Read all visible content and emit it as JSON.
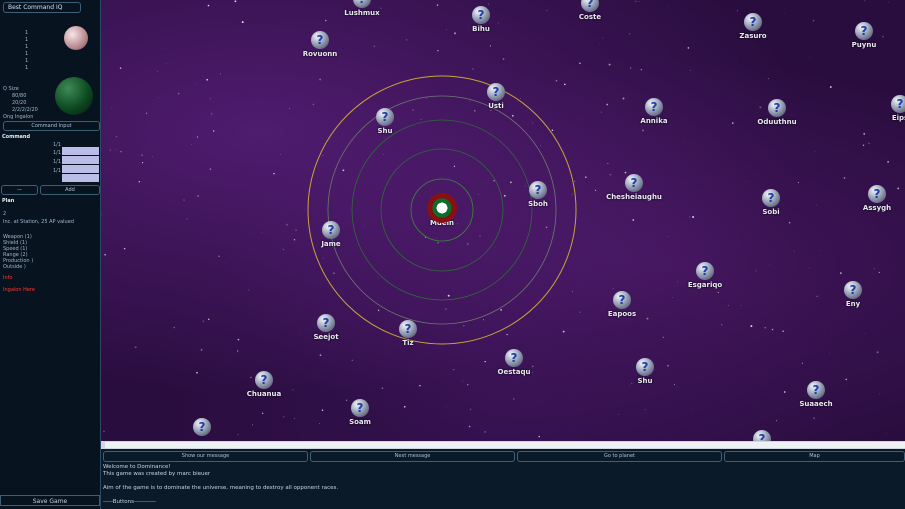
{
  "left_panel": {
    "title": "Best Command IQ",
    "rows_top": [
      "1",
      "1",
      "1",
      "1",
      "1",
      "1"
    ],
    "stats": [
      "Q Size",
      "80/80",
      "20/20",
      "2/2/2/2/20",
      "Ong Ingalon"
    ],
    "command_btn": "Command Input",
    "section_command": "Command",
    "bar_labels": [
      "1/1",
      "1/1",
      "1/1",
      "1/1"
    ],
    "btn_small_left": "—",
    "btn_small_right": "Add",
    "section_plan": "Plan",
    "plan_lines": [
      "2",
      "Inc. at Station, 25 AP valued"
    ],
    "resources": [
      "Weapon (1)",
      "Shield (1)",
      "Speed (1)",
      "Range (2)",
      "Production )",
      "Outside )"
    ],
    "red_lines": [
      "Info",
      "Ingalon Here"
    ],
    "save_label": "Save Game"
  },
  "map": {
    "home": {
      "name": "Muein"
    },
    "planets": [
      {
        "name": "Lushmux",
        "q": "?"
      },
      {
        "name": "Bihu",
        "q": "?"
      },
      {
        "name": "Coste",
        "q": "?"
      },
      {
        "name": "Zasuro",
        "q": "?"
      },
      {
        "name": "Puynu",
        "q": "?"
      },
      {
        "name": "Rovuonn",
        "q": "?"
      },
      {
        "name": "Usti",
        "q": "?"
      },
      {
        "name": "Annika",
        "q": "?"
      },
      {
        "name": "Oduuthnu",
        "q": "?"
      },
      {
        "name": "Eips",
        "q": "?"
      },
      {
        "name": "Shu",
        "q": "?"
      },
      {
        "name": "Sboh",
        "q": "?"
      },
      {
        "name": "Chesheiaughu",
        "q": "?"
      },
      {
        "name": "Sobi",
        "q": "?"
      },
      {
        "name": "Assygh",
        "q": "?"
      },
      {
        "name": "Jame",
        "q": "?"
      },
      {
        "name": "Esgariqo",
        "q": "?"
      },
      {
        "name": "Eny",
        "q": "?"
      },
      {
        "name": "Eapoos",
        "q": "?"
      },
      {
        "name": "Seejot",
        "q": "?"
      },
      {
        "name": "Tiz",
        "q": "?"
      },
      {
        "name": "Oestaqu",
        "q": "?"
      },
      {
        "name": "Chuanua",
        "q": "?"
      },
      {
        "name": "Shu",
        "q": "?"
      },
      {
        "name": "Suaaech",
        "q": "?"
      },
      {
        "name": "Soam",
        "q": "?"
      },
      {
        "name": "",
        "q": "?"
      },
      {
        "name": "",
        "q": "?"
      }
    ]
  },
  "bottom": {
    "buttons": [
      "Show our message",
      "Next message",
      "Go to planet",
      "Map"
    ],
    "log": [
      "Welcome to Dominance!",
      "This game was created by marc bieuer",
      "",
      "Aim of the game is to dominate the universe, meaning to destroy all opponent races.",
      "",
      "-----Buttons-----------"
    ]
  }
}
